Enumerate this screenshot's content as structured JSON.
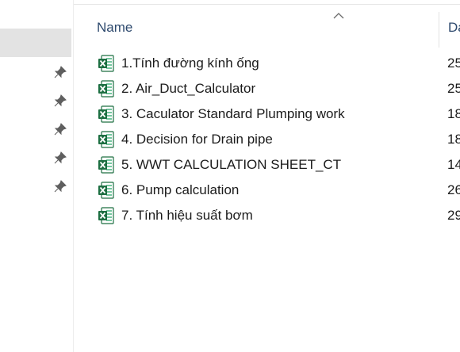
{
  "columns": {
    "name": "Name",
    "date": "Da"
  },
  "files": [
    {
      "name": "1.Tính đường kính ống",
      "date": "25",
      "icon": "excel-file-icon"
    },
    {
      "name": "2. Air_Duct_Calculator",
      "date": "25",
      "icon": "excel-file-icon"
    },
    {
      "name": "3. Caculator Standard Plumping work",
      "date": "18",
      "icon": "excel-file-icon"
    },
    {
      "name": "4. Decision for Drain pipe",
      "date": "18",
      "icon": "excel-file-icon"
    },
    {
      "name": "5. WWT CALCULATION SHEET_CT",
      "date": "14",
      "icon": "excel-file-icon"
    },
    {
      "name": "6. Pump calculation",
      "date": "26",
      "icon": "excel-file-icon"
    },
    {
      "name": "7. Tính hiệu suất bơm",
      "date": "29",
      "icon": "excel-file-icon"
    }
  ],
  "colors": {
    "excel_green": "#1d6f42",
    "header_text": "#2e4a6e",
    "selection": "#e3e3e3"
  }
}
